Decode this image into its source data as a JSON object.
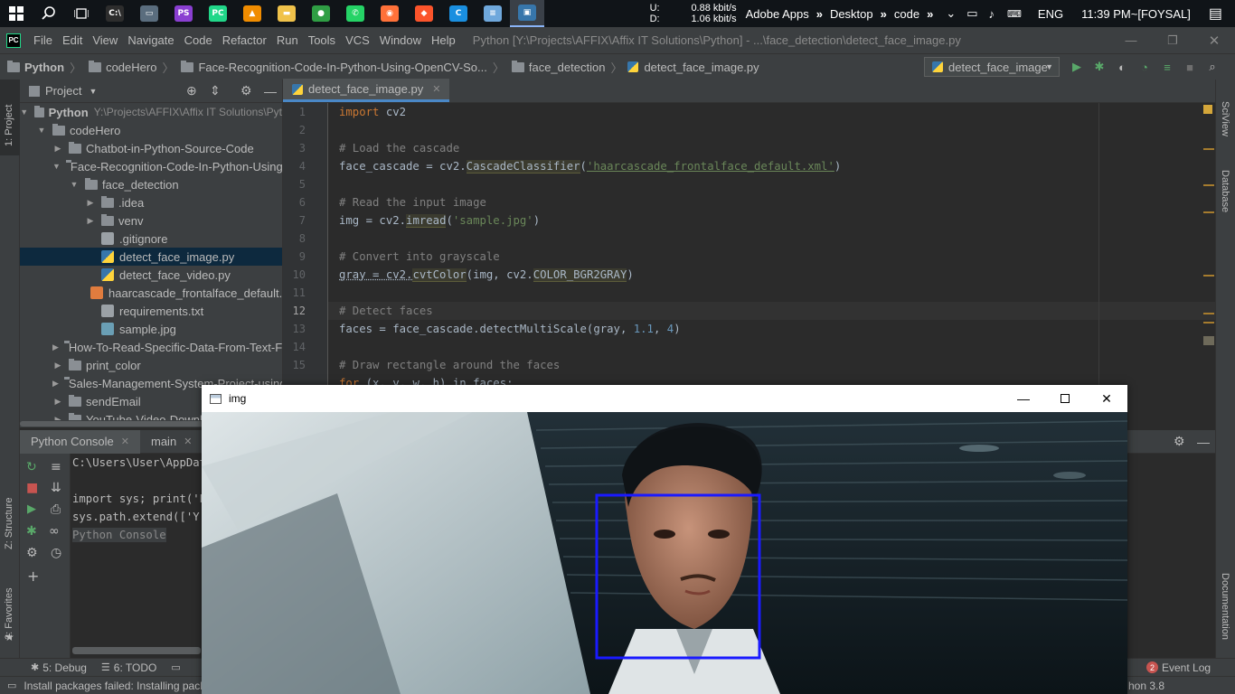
{
  "taskbar": {
    "apps": [
      {
        "name": "pycharm-cmd",
        "label": "C:\\",
        "color": "#2d2d2d"
      },
      {
        "name": "device-manager",
        "label": "▭",
        "color": "#5a6d7e"
      },
      {
        "name": "phpstorm",
        "label": "PS",
        "color": "#8a3fd1"
      },
      {
        "name": "pycharm-taskbar",
        "label": "PC",
        "color": "#21d789"
      },
      {
        "name": "vlc",
        "label": "▲",
        "color": "#f08c00"
      },
      {
        "name": "file-explorer",
        "label": "▬",
        "color": "#f0c24a"
      },
      {
        "name": "chrome",
        "label": "●",
        "color": "#2f9e44"
      },
      {
        "name": "whatsapp",
        "label": "✆",
        "color": "#25d366"
      },
      {
        "name": "firefox",
        "label": "◉",
        "color": "#ff7139"
      },
      {
        "name": "brave",
        "label": "◆",
        "color": "#fb542b"
      },
      {
        "name": "ccleaner",
        "label": "C",
        "color": "#1a8fe0"
      },
      {
        "name": "notepad",
        "label": "≡",
        "color": "#6fa8dc"
      },
      {
        "name": "python-image",
        "label": "▣",
        "color": "#3776ab"
      }
    ],
    "net_u_label": "U:",
    "net_d_label": "D:",
    "net_u": "0.88 kbit/s",
    "net_d": "1.06 kbit/s",
    "toolbars": [
      "Adobe Apps",
      "Desktop",
      "code"
    ],
    "lang": "ENG",
    "clock": "11:39 PM~[FOYSAL]"
  },
  "menu": {
    "logo": "PC",
    "items": [
      "File",
      "Edit",
      "View",
      "Navigate",
      "Code",
      "Refactor",
      "Run",
      "Tools",
      "VCS",
      "Window",
      "Help"
    ],
    "title": "Python [Y:\\Projects\\AFFIX\\Affix IT Solutions\\Python] - ...\\face_detection\\detect_face_image.py"
  },
  "nav": {
    "crumbs": [
      "Python",
      "codeHero",
      "Face-Recognition-Code-In-Python-Using-OpenCV-So...",
      "face_detection",
      "detect_face_image.py"
    ],
    "run_config": "detect_face_image"
  },
  "project": {
    "title": "Project",
    "root": "Python",
    "root_path": "Y:\\Projects\\AFFIX\\Affix IT Solutions\\Pyt",
    "nodes": [
      {
        "label": "codeHero",
        "depth": 1,
        "arrow": "▼",
        "type": "folder"
      },
      {
        "label": "Chatbot-in-Python-Source-Code",
        "depth": 2,
        "arrow": "▶",
        "type": "folder"
      },
      {
        "label": "Face-Recognition-Code-In-Python-Using",
        "depth": 2,
        "arrow": "▼",
        "type": "folder"
      },
      {
        "label": "face_detection",
        "depth": 3,
        "arrow": "▼",
        "type": "folder"
      },
      {
        "label": ".idea",
        "depth": 4,
        "arrow": "▶",
        "type": "folder"
      },
      {
        "label": "venv",
        "depth": 4,
        "arrow": "▶",
        "type": "folder"
      },
      {
        "label": ".gitignore",
        "depth": 4,
        "arrow": "",
        "type": "file"
      },
      {
        "label": "detect_face_image.py",
        "depth": 4,
        "arrow": "",
        "type": "py",
        "selected": true
      },
      {
        "label": "detect_face_video.py",
        "depth": 4,
        "arrow": "",
        "type": "py"
      },
      {
        "label": "haarcascade_frontalface_default.xml",
        "depth": 4,
        "arrow": "",
        "type": "xml"
      },
      {
        "label": "requirements.txt",
        "depth": 4,
        "arrow": "",
        "type": "file"
      },
      {
        "label": "sample.jpg",
        "depth": 4,
        "arrow": "",
        "type": "img"
      },
      {
        "label": "How-To-Read-Specific-Data-From-Text-F",
        "depth": 2,
        "arrow": "▶",
        "type": "folder"
      },
      {
        "label": "print_color",
        "depth": 2,
        "arrow": "▶",
        "type": "folder"
      },
      {
        "label": "Sales-Management-System-Project-using",
        "depth": 2,
        "arrow": "▶",
        "type": "folder"
      },
      {
        "label": "sendEmail",
        "depth": 2,
        "arrow": "▶",
        "type": "folder"
      },
      {
        "label": "YouTube-Video-Downlo",
        "depth": 2,
        "arrow": "▶",
        "type": "folder"
      }
    ]
  },
  "editor": {
    "tab": "detect_face_image.py",
    "line_numbers": [
      "1",
      "2",
      "3",
      "4",
      "5",
      "6",
      "7",
      "8",
      "9",
      "10",
      "11",
      "12",
      "13",
      "14",
      "15"
    ],
    "code_line_1_kw": "import",
    "code_line_1_rest": " cv2",
    "code_line_3": "# Load the cascade",
    "code_line_4_a": "face_cascade = cv2.",
    "code_line_4_fn": "CascadeClassifier",
    "code_line_4_b": "(",
    "code_line_4_str": "'haarcascade_frontalface_default.xml'",
    "code_line_4_c": ")",
    "code_line_6": "# Read the input image",
    "code_line_7_a": "img = cv2.",
    "code_line_7_fn": "imread",
    "code_line_7_b": "(",
    "code_line_7_str": "'sample.jpg'",
    "code_line_7_c": ")",
    "code_line_9": "# Convert into grayscale",
    "code_line_10_a": "gray = cv2.",
    "code_line_10_fn": "cvtColor",
    "code_line_10_b": "(img, cv2.",
    "code_line_10_const": "COLOR_BGR2GRAY",
    "code_line_10_c": ")",
    "code_line_12": "# Detect faces",
    "code_line_13_a": "faces = face_cascade.detectMultiScale(gray, ",
    "code_line_13_n1": "1.1",
    "code_line_13_b": ", ",
    "code_line_13_n2": "4",
    "code_line_13_c": ")",
    "code_line_15": "# Draw rectangle around the faces",
    "code_line_16_kw": "for",
    "code_line_16_rest": " (x, y, w, h) in faces:"
  },
  "console": {
    "tab1": "Python Console",
    "tab2": "main",
    "lines": [
      "C:\\Users\\User\\AppData",
      "",
      "import sys; print('Py",
      "sys.path.extend(['Y:'"
    ],
    "prompt": "Python Console"
  },
  "left_strip": {
    "project": "1: Project",
    "structure": "Z: Structure",
    "favorites": "2: Favorites"
  },
  "right_strip": {
    "sciview": "SciView",
    "database": "Database",
    "documentation": "Documentation"
  },
  "bottom": {
    "debug": "5: Debug",
    "todo": "6: TODO",
    "event_log": "Event Log",
    "event_count": "2",
    "interpreter": "hon 3.8"
  },
  "status": {
    "message": "Install packages failed: Installing pack"
  },
  "imgwin": {
    "title": "img"
  },
  "colors": {
    "accent": "#4a88c7",
    "detection_box": "#1a1aff",
    "selection": "#0d293e"
  }
}
